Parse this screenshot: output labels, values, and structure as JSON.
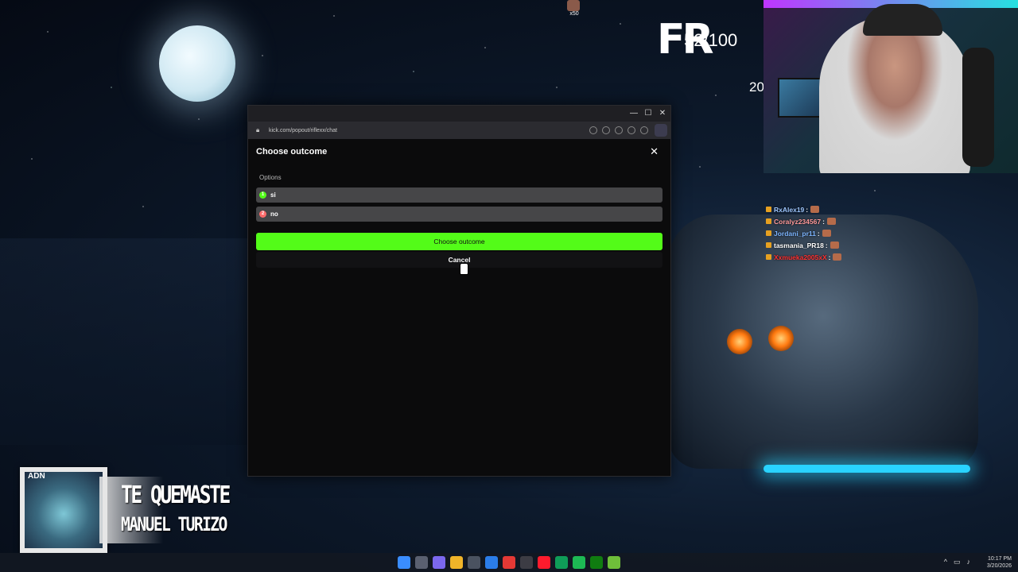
{
  "overlay": {
    "score_logo": "FR",
    "score_text": "52/100",
    "side_number": "20",
    "top_emote_count": "x50"
  },
  "chat": [
    {
      "user": "RxAlex19",
      "color": "#9ec7ff"
    },
    {
      "user": "Coralyz234567",
      "color": "#ff9a9a"
    },
    {
      "user": "Jordani_pr11",
      "color": "#7db5ff"
    },
    {
      "user": "tasmania_PR18",
      "color": "#ffffff"
    },
    {
      "user": "Xxmueka2005xX",
      "color": "#ff3030"
    }
  ],
  "song": {
    "title": "TE QUEMASTE",
    "artist": "MANUEL TURIZO",
    "art_tag": "ADN"
  },
  "browser": {
    "url": "kick.com/popout/riflexx/chat"
  },
  "modal": {
    "title": "Choose outcome",
    "close": "✕",
    "options_label": "Options",
    "options": [
      {
        "index": "1",
        "label": "si",
        "color": "#53fc18"
      },
      {
        "index": "2",
        "label": "no",
        "color": "#ff6b6b"
      }
    ],
    "primary_button": "Choose outcome",
    "cancel_button": "Cancel"
  },
  "taskbar": {
    "time": "10:17 PM",
    "date": "3/20/2026"
  }
}
